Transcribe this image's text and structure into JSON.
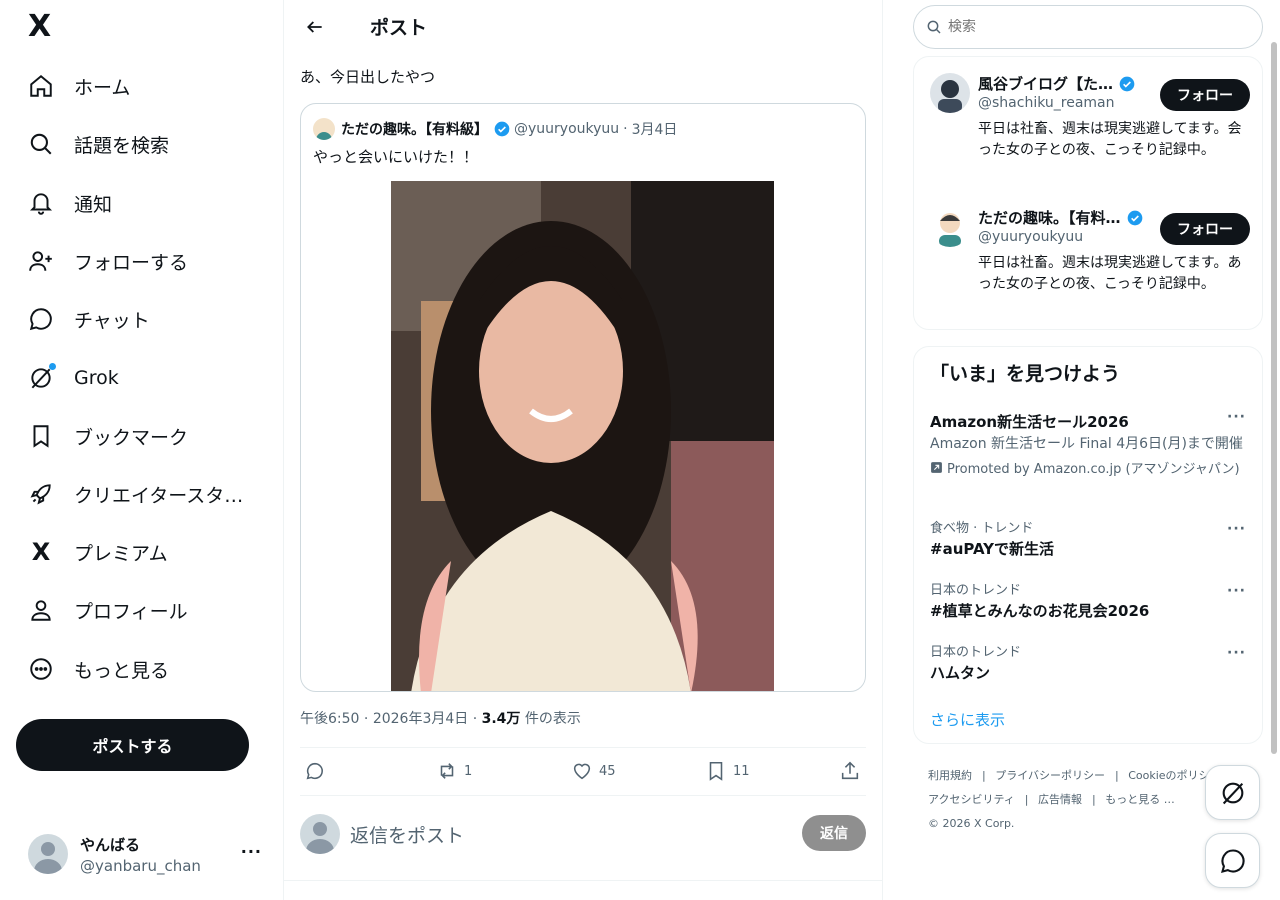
{
  "nav": {
    "logo": "X",
    "items": [
      {
        "label": "ホーム",
        "icon": "home-icon"
      },
      {
        "label": "話題を検索",
        "icon": "search-icon"
      },
      {
        "label": "通知",
        "icon": "bell-icon"
      },
      {
        "label": "フォローする",
        "icon": "follow-icon"
      },
      {
        "label": "チャット",
        "icon": "chat-icon"
      },
      {
        "label": "Grok",
        "icon": "grok-icon"
      },
      {
        "label": "ブックマーク",
        "icon": "bookmark-icon"
      },
      {
        "label": "クリエイタースタ…",
        "icon": "rocket-icon"
      },
      {
        "label": "プレミアム",
        "icon": "x-icon"
      },
      {
        "label": "プロフィール",
        "icon": "person-icon"
      },
      {
        "label": "もっと見る",
        "icon": "more-circle-icon"
      }
    ],
    "post_button": "ポストする",
    "account": {
      "display_name": "やんばる",
      "handle": "@yanbaru_chan"
    }
  },
  "main": {
    "title": "ポスト",
    "post_text": "あ、今日出したやつ",
    "quote": {
      "name": "ただの趣味。【有料級】",
      "handle": "@yuuryoukyuu",
      "date": "3月4日",
      "separator": "·",
      "text": "やっと会いにいけた！！"
    },
    "meta": {
      "time": "午後6:50",
      "date": "2026年3月4日",
      "separator": "·",
      "views": "3.4万",
      "views_label": "件の表示"
    },
    "actions": {
      "replies": "",
      "reposts": "1",
      "likes": "45",
      "bookmarks": "11"
    },
    "reply": {
      "placeholder": "返信をポスト",
      "button": "返信"
    }
  },
  "right": {
    "search_placeholder": "検索",
    "who_to_follow": [
      {
        "name": "風谷ブイログ【た…",
        "handle": "@shachiku_reaman",
        "bio": "平日は社畜、週末は現実逃避してます。会った女の子との夜、こっそり記録中。",
        "button": "フォロー"
      },
      {
        "name": "ただの趣味。【有料…",
        "handle": "@yuuryoukyuu",
        "bio": "平日は社畜。週末は現実逃避してます。あった女の子との夜、こっそり記録中。",
        "button": "フォロー"
      }
    ],
    "trends_title": "「いま」を見つけよう",
    "trends": [
      {
        "context": "",
        "title": "Amazon新生活セール2026",
        "subtitle": "Amazon 新生活セール Final 4月6日(月)まで開催",
        "promo": "Promoted by Amazon.co.jp (アマゾンジャパン)"
      },
      {
        "context": "食べ物 · トレンド",
        "title": "#auPAYで新生活"
      },
      {
        "context": "日本のトレンド",
        "title": "#植草とみんなのお花見会2026"
      },
      {
        "context": "日本のトレンド",
        "title": "ハムタン"
      }
    ],
    "show_more": "さらに表示",
    "footer": {
      "links": [
        "利用規約",
        "プライバシーポリシー",
        "Cookieのポリシー",
        "アクセシビリティ",
        "広告情報",
        "もっと見る …"
      ],
      "separator": "|",
      "copyright": "© 2026 X Corp."
    }
  },
  "colors": {
    "accent": "#1d9bf0",
    "text": "#0f1419",
    "muted": "#536471",
    "border": "#eff3f4"
  }
}
